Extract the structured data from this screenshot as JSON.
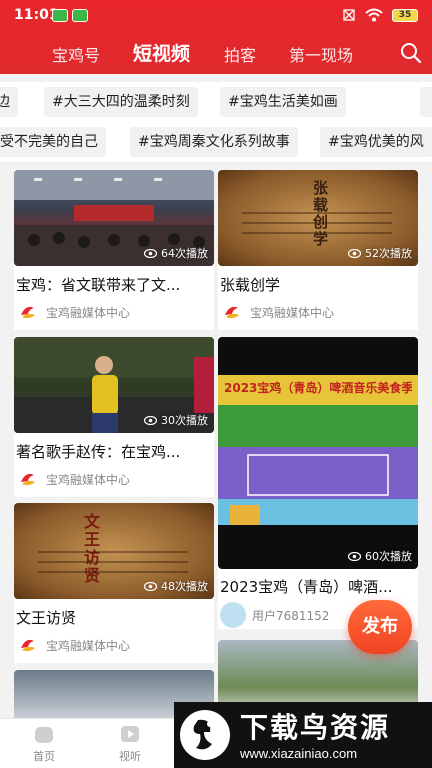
{
  "status_bar": {
    "time": "11:01",
    "battery": "35"
  },
  "header_tabs": [
    "宝鸡号",
    "短视频",
    "拍客",
    "第一现场"
  ],
  "tag_rows": [
    [
      "边",
      "#大三大四的温柔时刻",
      "#宝鸡生活美如画"
    ],
    [
      "受不完美的自己",
      "#宝鸡周秦文化系列故事",
      "#宝鸡优美的风"
    ]
  ],
  "cards": [
    {
      "title": "宝鸡：省文联带来了文...",
      "views": "64次播放",
      "author": "宝鸡融媒体中心"
    },
    {
      "title": "张载创学",
      "views": "52次播放",
      "author": "宝鸡融媒体中心",
      "thumb_text": "张载创学"
    },
    {
      "title": "著名歌手赵传：在宝鸡...",
      "views": "30次播放",
      "author": "宝鸡融媒体中心"
    },
    {
      "title": "2023宝鸡（青岛）啤酒...",
      "views": "60次播放",
      "author": "用户7681152",
      "thumb_text": "2023宝鸡（青岛）啤酒音乐美食季"
    },
    {
      "title": "文王访贤",
      "views": "48次播放",
      "author": "宝鸡融媒体中心",
      "thumb_text": "文王访贤"
    }
  ],
  "fab_label": "发布",
  "bottom_nav": [
    "首页",
    "视听"
  ],
  "watermark": {
    "title": "下载鸟资源",
    "url": "www.xiazainiao.com"
  }
}
